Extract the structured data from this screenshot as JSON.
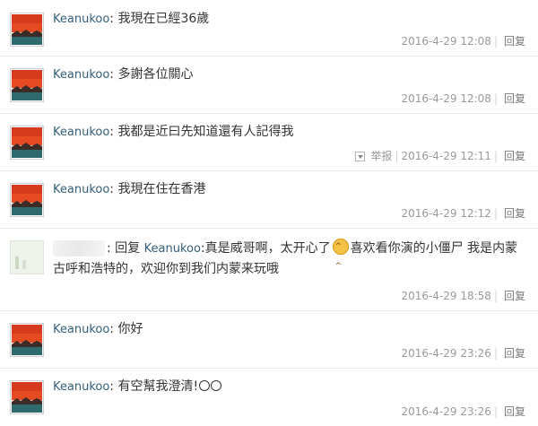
{
  "comments": [
    {
      "user": "Keanukoo",
      "sep": ": ",
      "text": "我現在已經36歲",
      "time": "2016-4-29 12:08",
      "reply": "回复"
    },
    {
      "user": "Keanukoo",
      "sep": ": ",
      "text": "多謝各位關心",
      "time": "2016-4-29 12:08",
      "reply": "回复"
    },
    {
      "user": "Keanukoo",
      "sep": ": ",
      "text": "我都是近曰先知道還有人記得我",
      "time": "2016-4-29 12:11",
      "reply": "回复",
      "report": "举报"
    },
    {
      "user": "Keanukoo",
      "sep": ": ",
      "text": "我現在住在香港",
      "time": "2016-4-29 12:12",
      "reply": "回复"
    },
    {
      "user_blurred": ":",
      "reply_prefix": "回复",
      "reply_to": "Keanukoo",
      "text1": ":真是威哥啊，太开心了",
      "text2": "喜欢看你演的小僵尸 我是内蒙古呼和浩特的，欢迎你到我们内蒙来玩哦",
      "time": "2016-4-29 18:58",
      "reply": "回复"
    },
    {
      "user": "Keanukoo",
      "sep": ": ",
      "text": "你好",
      "time": "2016-4-29 23:26",
      "reply": "回复"
    },
    {
      "user": "Keanukoo",
      "sep": ": ",
      "text": "有空幫我澄清!",
      "time": "2016-4-29 23:26",
      "reply": "回复"
    }
  ],
  "icons": {
    "avatar": "sunset-landscape-avatar",
    "emoji": "smile-emoji",
    "dropdown": "dropdown-arrow-icon"
  }
}
